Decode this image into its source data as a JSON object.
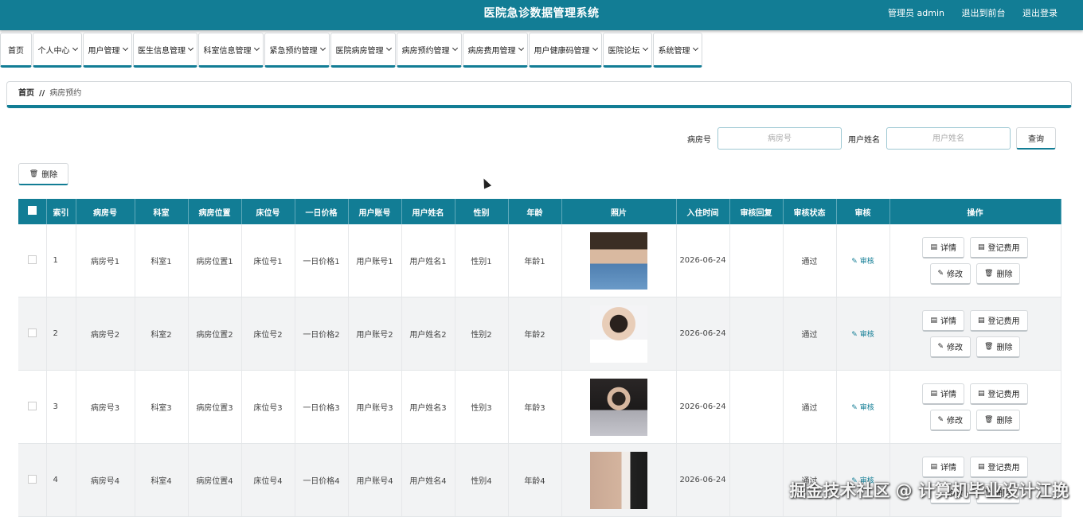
{
  "header": {
    "title": "医院急诊数据管理系统",
    "admin": "管理员 admin",
    "front": "退出到前台",
    "logout": "退出登录"
  },
  "nav": [
    {
      "label": "首页",
      "w": 40,
      "chev": false
    },
    {
      "label": "个人中心",
      "w": 62,
      "chev": true
    },
    {
      "label": "用户管理",
      "w": 62,
      "chev": true
    },
    {
      "label": "医生信息管理",
      "w": 81,
      "chev": true
    },
    {
      "label": "科室信息管理",
      "w": 82,
      "chev": true
    },
    {
      "label": "紧急预约管理",
      "w": 82,
      "chev": true
    },
    {
      "label": "医院病房管理",
      "w": 82,
      "chev": true
    },
    {
      "label": "病房预约管理",
      "w": 82,
      "chev": true
    },
    {
      "label": "病房费用管理",
      "w": 82,
      "chev": true
    },
    {
      "label": "用户健康码管理",
      "w": 92,
      "chev": true
    },
    {
      "label": "医院论坛",
      "w": 62,
      "chev": true
    },
    {
      "label": "系统管理",
      "w": 62,
      "chev": true
    }
  ],
  "breadcrumb": {
    "home": "首页",
    "sep": "//",
    "current": "病房预约"
  },
  "search": {
    "room_label": "病房号",
    "room_placeholder": "病房号",
    "user_label": "用户姓名",
    "user_placeholder": "用户姓名",
    "query": "查询"
  },
  "delete_label": "删除",
  "columns": [
    "索引",
    "病房号",
    "科室",
    "病房位置",
    "床位号",
    "一日价格",
    "用户账号",
    "用户姓名",
    "性别",
    "年龄",
    "照片",
    "入住时间",
    "审核回复",
    "审核状态",
    "审核",
    "操作"
  ],
  "rows": [
    {
      "idx": "1",
      "room": "病房号1",
      "dept": "科室1",
      "loc": "病房位置1",
      "bed": "床位号1",
      "price": "一日价格1",
      "acct": "用户账号1",
      "name": "用户姓名1",
      "sex": "性别1",
      "age": "年龄1",
      "photo": "p1",
      "date": "2026-06-24",
      "reply": "",
      "status": "通过"
    },
    {
      "idx": "2",
      "room": "病房号2",
      "dept": "科室2",
      "loc": "病房位置2",
      "bed": "床位号2",
      "price": "一日价格2",
      "acct": "用户账号2",
      "name": "用户姓名2",
      "sex": "性别2",
      "age": "年龄2",
      "photo": "p2",
      "date": "2026-06-24",
      "reply": "",
      "status": "通过"
    },
    {
      "idx": "3",
      "room": "病房号3",
      "dept": "科室3",
      "loc": "病房位置3",
      "bed": "床位号3",
      "price": "一日价格3",
      "acct": "用户账号3",
      "name": "用户姓名3",
      "sex": "性别3",
      "age": "年龄3",
      "photo": "p3",
      "date": "2026-06-24",
      "reply": "",
      "status": "通过"
    },
    {
      "idx": "4",
      "room": "病房号4",
      "dept": "科室4",
      "loc": "病房位置4",
      "bed": "床位号4",
      "price": "一日价格4",
      "acct": "用户账号4",
      "name": "用户姓名4",
      "sex": "性别4",
      "age": "年龄4",
      "photo": "p4",
      "date": "2026-06-24",
      "reply": "",
      "status": "通过"
    }
  ],
  "row_actions": {
    "audit": "审核",
    "detail": "详情",
    "fee": "登记费用",
    "edit": "修改",
    "delete": "删除"
  },
  "watermark": "掘金技术社区 @ 计算机毕业设计江挽",
  "colors": {
    "primary": "#127d95",
    "header_text": "#ffffff"
  }
}
